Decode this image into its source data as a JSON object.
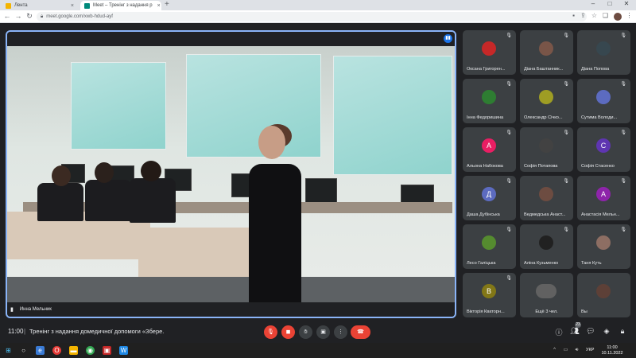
{
  "browser": {
    "tabs": [
      {
        "title": "Лента",
        "favicon_color": "#f4b400"
      },
      {
        "title": "Meet – Тренінг з надання р",
        "favicon_color": "#00897b"
      }
    ],
    "url": "meet.google.com/xwb-hdud-ayf",
    "new_tab": "+",
    "window_controls": [
      "–",
      "□",
      "✕"
    ]
  },
  "meeting": {
    "time": "11:00",
    "separator": "|",
    "title": "Тренінг з надання домедичної допомоги «Збере...",
    "presenter_name": "Инна Мельник",
    "participant_badge": "23"
  },
  "participants": [
    {
      "name": "Оксана Григорен...",
      "avatar_type": "photo",
      "color": "#c62828"
    },
    {
      "name": "Діана Баштанник...",
      "avatar_type": "photo",
      "color": "#795548"
    },
    {
      "name": "Діана Попова",
      "avatar_type": "photo",
      "color": "#37474f"
    },
    {
      "name": "Інна Федоришина",
      "avatar_type": "photo",
      "color": "#2e7d32"
    },
    {
      "name": "Олександр Січко...",
      "avatar_type": "photo",
      "color": "#9e9d24"
    },
    {
      "name": "Сутима Володи...",
      "avatar_type": "photo",
      "color": "#5c6bc0"
    },
    {
      "name": "Альона Набокова",
      "avatar_type": "letter",
      "letter": "А",
      "color": "#e91e63"
    },
    {
      "name": "Софія Потапова",
      "avatar_type": "photo",
      "color": "#424242"
    },
    {
      "name": "Софія Стасенко",
      "avatar_type": "letter",
      "letter": "С",
      "color": "#5e35b1"
    },
    {
      "name": "Даша Дубінська",
      "avatar_type": "letter",
      "letter": "Д",
      "color": "#5c6bc0"
    },
    {
      "name": "Ведмедська Анаст...",
      "avatar_type": "photo",
      "color": "#6d4c41"
    },
    {
      "name": "Анастасія Мельн...",
      "avatar_type": "letter",
      "letter": "А",
      "color": "#8e24aa"
    },
    {
      "name": "Лесо Галіцька",
      "avatar_type": "photo",
      "color": "#558b2f"
    },
    {
      "name": "Аліна Кузьменко",
      "avatar_type": "photo",
      "color": "#212121"
    },
    {
      "name": "Таня Куть",
      "avatar_type": "photo",
      "color": "#8d6e63"
    },
    {
      "name": "Вікторія Кваторн...",
      "avatar_type": "letter",
      "letter": "В",
      "color": "#827717"
    },
    {
      "name": "Ещё 3 чел.",
      "avatar_type": "group",
      "color": "#616161"
    },
    {
      "name": "Вы",
      "avatar_type": "photo",
      "color": "#5d4037"
    }
  ],
  "controls": {
    "mic_icon": "mic-off-icon",
    "camera_icon": "camera-off-icon",
    "hand_icon": "raise-hand-icon",
    "present_icon": "present-icon",
    "more_icon": "more-vertical-icon",
    "hangup_icon": "hangup-icon",
    "info_icon": "info-icon",
    "people_icon": "people-icon",
    "chat_icon": "chat-icon",
    "activities_icon": "activities-icon",
    "lock_icon": "lock-icon"
  },
  "taskbar": {
    "lang": "УКР",
    "time": "11:00",
    "date": "10.11.2022"
  }
}
